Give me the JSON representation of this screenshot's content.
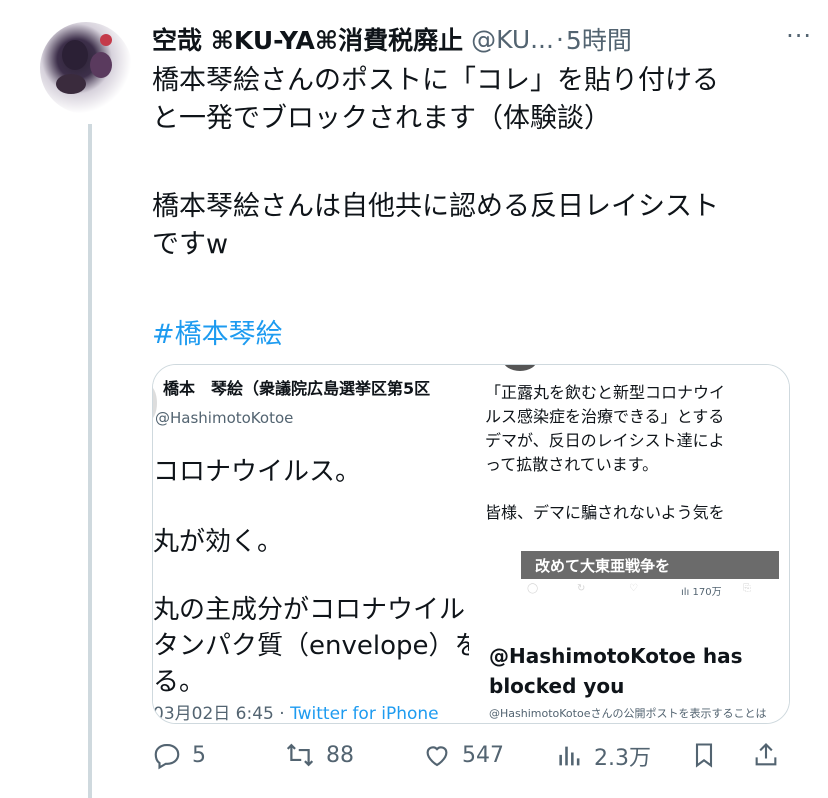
{
  "tweet": {
    "display_name": "空哉 ⌘KU-YA⌘消費税廃止",
    "handle": "@KU...",
    "dot": "·",
    "time": "5時間",
    "more": "···",
    "text_lines": [
      "橋本琴絵さんのポストに「コレ」を貼り付ける",
      "と一発でブロックされます（体験談）",
      "橋本琴絵さんは自他共に認める反日レイシスト",
      "ですw"
    ],
    "hashtag": "#橋本琴絵"
  },
  "media": {
    "left": {
      "name": "橋本　琴絵（衆議院広島選挙区第5区",
      "handle": "@HashimotoKotoe",
      "lines": [
        "コロナウイルス。",
        "丸が効く。",
        "丸の主成分がコロナウイル",
        "タンパク質（envelope）を",
        "る。"
      ],
      "date": "03月02日 6:45",
      "sep": " · ",
      "app": "Twitter for iPhone"
    },
    "right": {
      "text_lines": [
        "「正露丸を飲むと新型コロナウイ",
        "ルス感染症を治療できる」とする",
        "デマが、反日のレイシスト達によ",
        "って拡散されています。",
        "",
        "皆様、デマに騙されないよう気を"
      ],
      "video_text": "改めて大東亜戦争を",
      "views": "170万",
      "blocked_title": "@HashimotoKotoe has blocked you",
      "blocked_sub": "@HashimotoKotoeさんの公開ポストを表示することは"
    }
  },
  "actions": {
    "replies": "5",
    "retweets": "88",
    "likes": "547",
    "views": "2.3万"
  },
  "colors": {
    "accent": "#1d9bf0",
    "muted": "#536471",
    "text": "#0f1419",
    "border": "#cfd9de"
  }
}
